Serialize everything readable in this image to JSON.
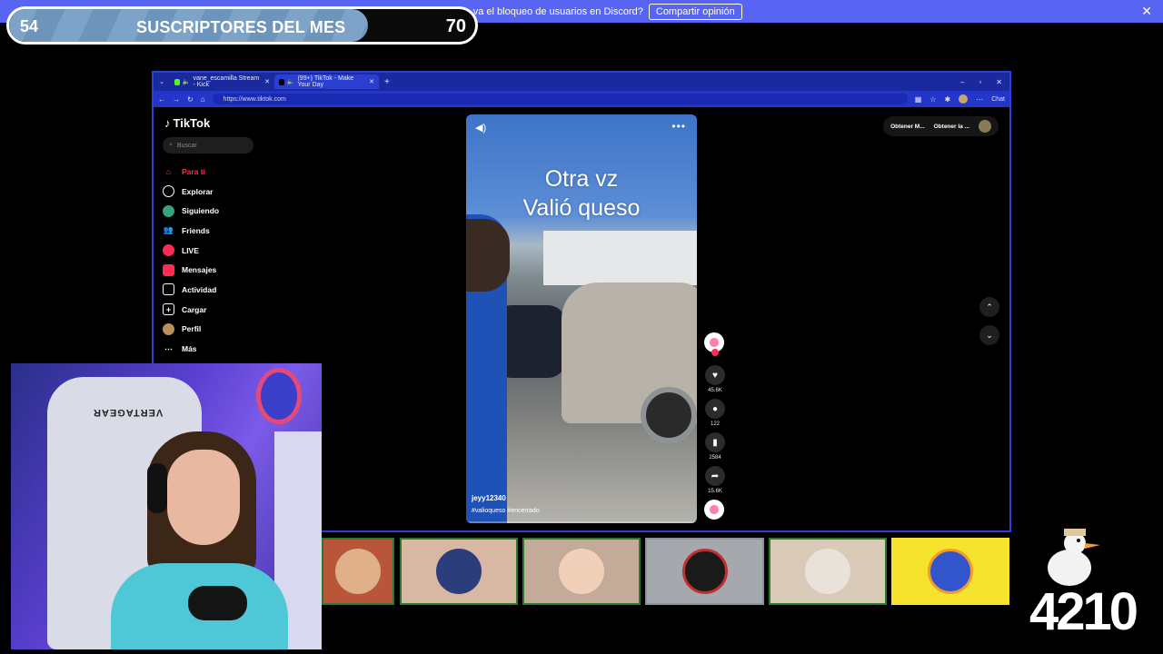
{
  "discord_banner": {
    "text": "¿Qué tal te va el bloqueo de usuarios en Discord?",
    "button": "Compartir opinión",
    "close": "✕"
  },
  "sub_goal": {
    "current": "54",
    "title": "SUSCRIPTORES DEL MES",
    "target": "70",
    "progress": 0.77
  },
  "browser": {
    "tabs": [
      {
        "title": "vane_escamilla Stream - Kick",
        "active": false
      },
      {
        "title": "(99+) TikTok - Make Your Day",
        "active": true
      }
    ],
    "new_tab": "+",
    "window_controls": [
      "–",
      "▫",
      "✕"
    ],
    "url": "https://www.tiktok.com",
    "chat_label": "Chat"
  },
  "tiktok": {
    "logo": "TikTok",
    "search_placeholder": "Buscar",
    "nav": [
      {
        "label": "Para ti",
        "icon": "home-icon",
        "active": true
      },
      {
        "label": "Explorar",
        "icon": "compass-icon",
        "active": false
      },
      {
        "label": "Siguiendo",
        "icon": "following-icon",
        "active": false
      },
      {
        "label": "Friends",
        "icon": "friends-icon",
        "active": false
      },
      {
        "label": "LIVE",
        "icon": "live-icon",
        "active": false
      },
      {
        "label": "Mensajes",
        "icon": "messages-icon",
        "active": false
      },
      {
        "label": "Actividad",
        "icon": "activity-icon",
        "active": false
      },
      {
        "label": "Cargar",
        "icon": "upload-icon",
        "active": false
      },
      {
        "label": "Perfil",
        "icon": "profile-icon",
        "active": false
      },
      {
        "label": "Más",
        "icon": "more-icon",
        "active": false
      }
    ],
    "top_right": {
      "item1": "Obtener M...",
      "item2": "Obtener la ..."
    },
    "video": {
      "caption_line1": "Otra vz",
      "caption_line2": "Valió queso",
      "author": "jeyy12340",
      "tags": "#valioqueso #encerrado"
    },
    "actions": {
      "likes": "45.6K",
      "comments": "122",
      "saves": "2584",
      "shares": "15.6K"
    }
  },
  "overlay_number": "4210",
  "colors": {
    "discord": "#5865f2",
    "browser_frame": "#2d3fd6",
    "tiktok_red": "#fe2c55"
  }
}
